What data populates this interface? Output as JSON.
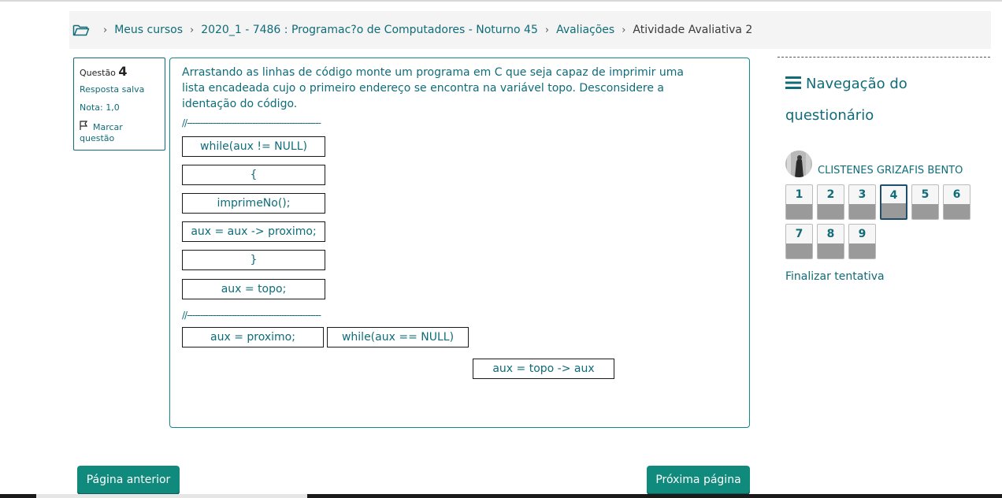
{
  "breadcrumb": {
    "items": [
      "Meus cursos",
      "2020_1 - 7486 : Programac?o de Computadores - Noturno 45",
      "Avaliações"
    ],
    "current": "Atividade Avaliativa 2"
  },
  "question_info": {
    "label": "Questão",
    "number": "4",
    "status": "Resposta salva",
    "grade": "Nota: 1,0",
    "flag_label_1": "Marcar",
    "flag_label_2": "questão"
  },
  "question": {
    "text": "Arrastando as linhas de código monte um programa em C que seja capaz de imprimir uma lista encadeada cujo o primeiro endereço se encontra na variável topo. Desconsidere a identação do código.",
    "divider_top": "//---------------------------------------------------",
    "divider_bottom": "//---------------------------------------------------",
    "answer_lines": [
      "while(aux != NULL)",
      "{",
      "imprimeNo();",
      "aux = aux -> proximo;",
      "}",
      "aux = topo;"
    ],
    "options": [
      "aux = proximo;",
      "while(aux == NULL)",
      "aux = topo -> aux"
    ]
  },
  "nav": {
    "title": "Navegação do questionário",
    "user_name": "CLISTENES GRIZAFIS BENTO",
    "questions": [
      "1",
      "2",
      "3",
      "4",
      "5",
      "6",
      "7",
      "8",
      "9"
    ],
    "current": "4",
    "finish": "Finalizar tentativa"
  },
  "buttons": {
    "prev": "Página anterior",
    "next": "Próxima página"
  },
  "colors": {
    "accent": "#0f6c78",
    "button": "#0f8a7c"
  }
}
